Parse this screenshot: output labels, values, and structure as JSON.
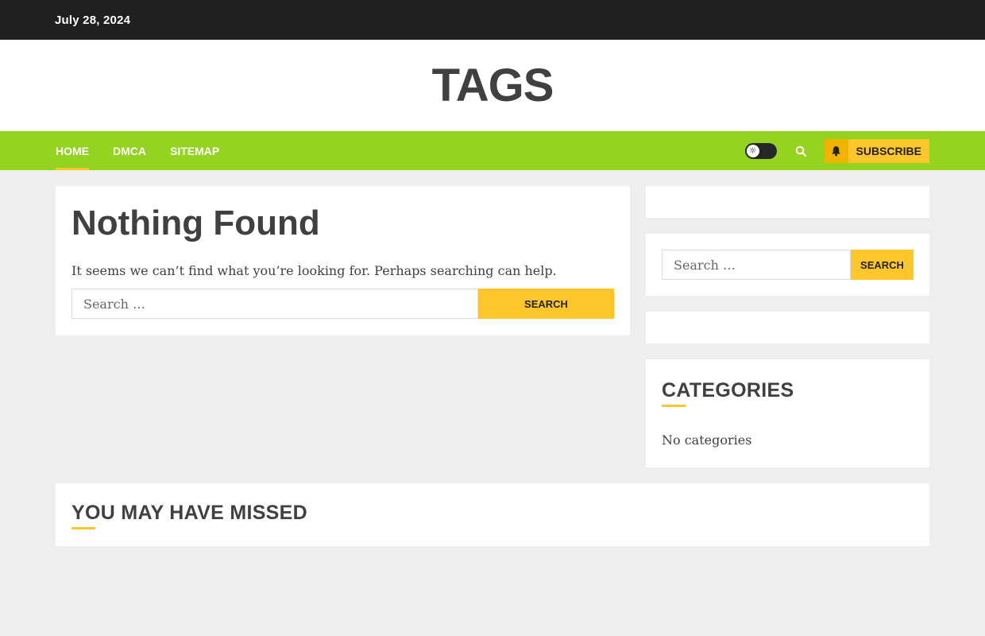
{
  "topbar": {
    "date": "July 28, 2024"
  },
  "site": {
    "title": "TAGS"
  },
  "nav": {
    "items": [
      {
        "label": "HOME"
      },
      {
        "label": "DMCA"
      },
      {
        "label": "SITEMAP"
      }
    ],
    "subscribe_label": "SUBSCRIBE"
  },
  "main": {
    "title": "Nothing Found",
    "notice": "It seems we can’t find what you’re looking for. Perhaps searching can help.",
    "search": {
      "placeholder": "Search …",
      "button": "Search"
    }
  },
  "sidebar": {
    "search": {
      "placeholder": "Search …",
      "button": "Search"
    },
    "categories": {
      "title": "CATEGORIES",
      "empty": "No categories"
    }
  },
  "missed": {
    "title": "YOU MAY HAVE MISSED"
  },
  "colors": {
    "nav": "#94d31f",
    "accent": "#ffc72c",
    "topbar": "#202020"
  }
}
